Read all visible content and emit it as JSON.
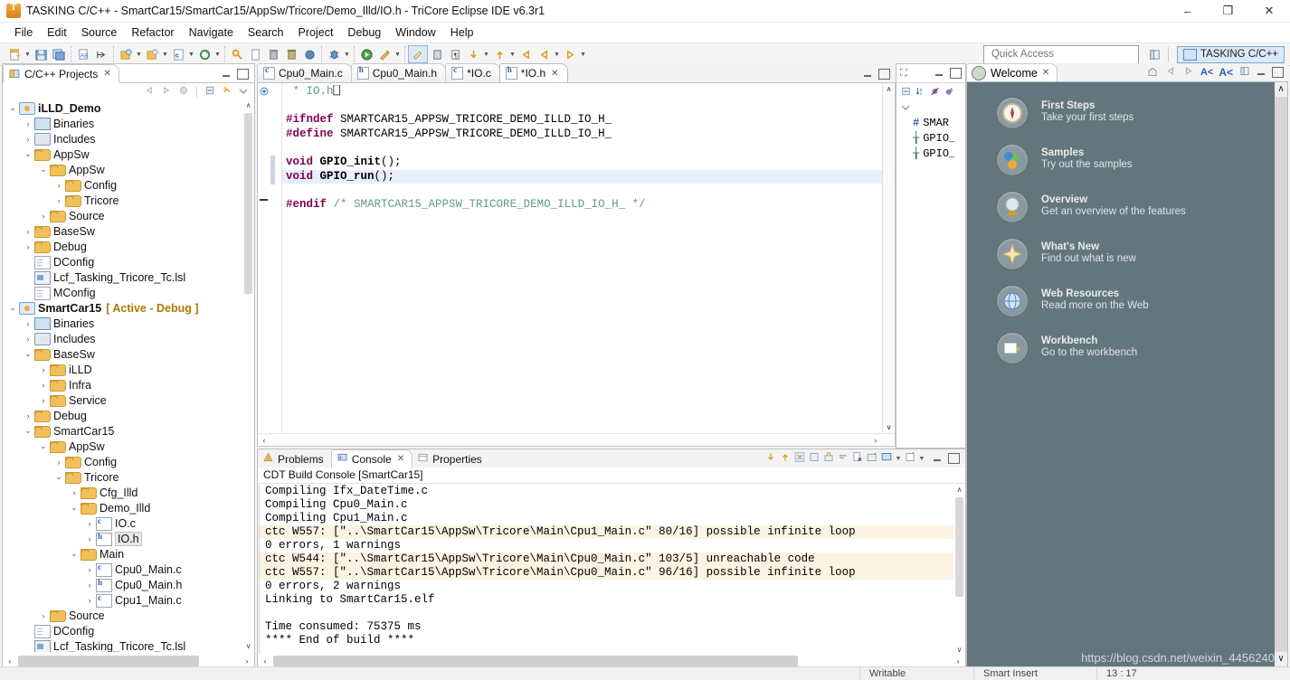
{
  "window": {
    "title": "TASKING C/C++ - SmartCar15/SmartCar15/AppSw/Tricore/Demo_Illd/IO.h - TriCore Eclipse IDE v6.3r1",
    "app_icon": "tasking-icon",
    "minimize": "–",
    "maximize": "❐",
    "close": "✕"
  },
  "menubar": [
    "File",
    "Edit",
    "Source",
    "Refactor",
    "Navigate",
    "Search",
    "Project",
    "Debug",
    "Window",
    "Help"
  ],
  "toolbar": {
    "quick_access_placeholder": "Quick Access",
    "perspective_label": "TASKING C/C++",
    "groups": [
      [
        "new-wizard-icon",
        "▾",
        "save-icon",
        "save-all-icon"
      ],
      [
        "print-icon",
        "next-annotation-icon"
      ],
      [
        "build-icon",
        "▾",
        "clean-icon",
        "▾",
        "build-config-icon",
        "▾",
        "refresh-icon",
        "▾"
      ],
      [
        "search-icon",
        "open-file-icon",
        "delete-icon",
        "trash-icon",
        "scan-icon"
      ],
      [
        "debug-icon",
        "▾"
      ],
      [
        "run-icon",
        "external-tools-icon",
        "▾"
      ],
      [
        "toggle-mark-icon",
        "block-select-icon",
        "show-whitespace-icon",
        "last-edit-icon",
        "▾",
        "next-member-icon",
        "▾",
        "back-icon",
        "forward-icon",
        "▾",
        "forward-nav-icon",
        "▾"
      ]
    ]
  },
  "projects": {
    "tab_label": "C/C++ Projects",
    "toolbar_icons": [
      "back-icon",
      "forward-icon",
      "home-icon",
      "collapse-all-icon",
      "link-editor-icon",
      "view-menu-icon"
    ],
    "tree": [
      {
        "indent": 0,
        "twist": "⌄",
        "icon": "project-icon",
        "label": "iLLD_Demo",
        "bold": true
      },
      {
        "indent": 1,
        "twist": "›",
        "icon": "binaries-icon",
        "label": "Binaries"
      },
      {
        "indent": 1,
        "twist": "›",
        "icon": "includes-icon",
        "label": "Includes"
      },
      {
        "indent": 1,
        "twist": "⌄",
        "icon": "folder-icon",
        "label": "AppSw"
      },
      {
        "indent": 2,
        "twist": "⌄",
        "icon": "folder-icon",
        "label": "AppSw"
      },
      {
        "indent": 3,
        "twist": "›",
        "icon": "folder-icon",
        "label": "Config"
      },
      {
        "indent": 3,
        "twist": "›",
        "icon": "folder-icon",
        "label": "Tricore"
      },
      {
        "indent": 2,
        "twist": "›",
        "icon": "folder-icon",
        "label": "Source"
      },
      {
        "indent": 1,
        "twist": "›",
        "icon": "folder-icon",
        "label": "BaseSw"
      },
      {
        "indent": 1,
        "twist": "›",
        "icon": "folder-icon",
        "label": "Debug"
      },
      {
        "indent": 1,
        "twist": "",
        "icon": "file-icon",
        "label": "DConfig"
      },
      {
        "indent": 1,
        "twist": "",
        "icon": "lsl-icon",
        "label": "Lcf_Tasking_Tricore_Tc.lsl"
      },
      {
        "indent": 1,
        "twist": "",
        "icon": "file-icon",
        "label": "MConfig"
      },
      {
        "indent": 0,
        "twist": "⌄",
        "icon": "project-icon",
        "label": "SmartCar15",
        "bold": true,
        "suffix": "[ Active - Debug ]"
      },
      {
        "indent": 1,
        "twist": "›",
        "icon": "binaries-icon",
        "label": "Binaries"
      },
      {
        "indent": 1,
        "twist": "›",
        "icon": "includes-icon",
        "label": "Includes"
      },
      {
        "indent": 1,
        "twist": "⌄",
        "icon": "folder-icon",
        "label": "BaseSw"
      },
      {
        "indent": 2,
        "twist": "›",
        "icon": "folder-icon",
        "label": "iLLD"
      },
      {
        "indent": 2,
        "twist": "›",
        "icon": "folder-icon",
        "label": "Infra"
      },
      {
        "indent": 2,
        "twist": "›",
        "icon": "folder-icon",
        "label": "Service"
      },
      {
        "indent": 1,
        "twist": "›",
        "icon": "folder-icon",
        "label": "Debug"
      },
      {
        "indent": 1,
        "twist": "⌄",
        "icon": "folder-icon",
        "label": "SmartCar15"
      },
      {
        "indent": 2,
        "twist": "⌄",
        "icon": "folder-icon",
        "label": "AppSw"
      },
      {
        "indent": 3,
        "twist": "›",
        "icon": "folder-icon",
        "label": "Config"
      },
      {
        "indent": 3,
        "twist": "⌄",
        "icon": "folder-icon",
        "label": "Tricore"
      },
      {
        "indent": 4,
        "twist": "›",
        "icon": "folder-icon",
        "label": "Cfg_Illd"
      },
      {
        "indent": 4,
        "twist": "⌄",
        "icon": "folder-icon",
        "label": "Demo_Illd"
      },
      {
        "indent": 5,
        "twist": "›",
        "icon": "c-file-icon",
        "label": "IO.c"
      },
      {
        "indent": 5,
        "twist": "›",
        "icon": "h-file-icon",
        "label": "IO.h",
        "selected": true
      },
      {
        "indent": 4,
        "twist": "⌄",
        "icon": "folder-icon",
        "label": "Main"
      },
      {
        "indent": 5,
        "twist": "›",
        "icon": "c-file-icon",
        "label": "Cpu0_Main.c"
      },
      {
        "indent": 5,
        "twist": "›",
        "icon": "h-file-icon",
        "label": "Cpu0_Main.h"
      },
      {
        "indent": 5,
        "twist": "›",
        "icon": "c-file-icon",
        "label": "Cpu1_Main.c"
      },
      {
        "indent": 2,
        "twist": "›",
        "icon": "folder-icon",
        "label": "Source"
      },
      {
        "indent": 1,
        "twist": "",
        "icon": "file-icon",
        "label": "DConfig"
      },
      {
        "indent": 1,
        "twist": "",
        "icon": "lsl-icon",
        "label": "Lcf_Tasking_Tricore_Tc.lsl"
      },
      {
        "indent": 1,
        "twist": "",
        "icon": "file-icon",
        "label": "MConfig"
      }
    ]
  },
  "editor": {
    "tabs": [
      {
        "label": "Cpu0_Main.c",
        "icon": "c-file-icon",
        "active": false,
        "dirty": false
      },
      {
        "label": "Cpu0_Main.h",
        "icon": "h-file-icon",
        "active": false,
        "dirty": false
      },
      {
        "label": "*IO.c",
        "icon": "c-file-icon",
        "active": false,
        "dirty": true
      },
      {
        "label": "*IO.h",
        "icon": "h-file-icon",
        "active": true,
        "dirty": true
      }
    ],
    "lines": [
      {
        "segments": [
          {
            "t": " * IO.h",
            "c": "cmt"
          },
          {
            "t": "⎕",
            "c": "plain"
          }
        ]
      },
      {
        "segments": []
      },
      {
        "segments": [
          {
            "t": "#ifndef",
            "c": "pp"
          },
          {
            "t": " SMARTCAR15_APPSW_TRICORE_DEMO_ILLD_IO_H_",
            "c": "plain"
          }
        ]
      },
      {
        "segments": [
          {
            "t": "#define",
            "c": "pp"
          },
          {
            "t": " SMARTCAR15_APPSW_TRICORE_DEMO_ILLD_IO_H_",
            "c": "plain"
          }
        ]
      },
      {
        "segments": []
      },
      {
        "segments": [
          {
            "t": "void",
            "c": "kw"
          },
          {
            "t": " ",
            "c": "plain"
          },
          {
            "t": "GPIO_init",
            "c": "fn"
          },
          {
            "t": "();",
            "c": "plain"
          }
        ],
        "changed": true
      },
      {
        "segments": [
          {
            "t": "void",
            "c": "kw"
          },
          {
            "t": " ",
            "c": "plain"
          },
          {
            "t": "GPIO_run",
            "c": "fn"
          },
          {
            "t": "();",
            "c": "plain"
          }
        ],
        "highlight": true,
        "changed": true
      },
      {
        "segments": []
      },
      {
        "segments": [
          {
            "t": "#endif",
            "c": "pp"
          },
          {
            "t": " ",
            "c": "plain"
          },
          {
            "t": "/* SMARTCAR15_APPSW_TRICORE_DEMO_ILLD_IO_H_ */",
            "c": "cmt"
          }
        ]
      }
    ]
  },
  "outline": {
    "tab_icon": "outline-icon",
    "toolbar_icons": [
      "collapse-all-icon",
      "sort-icon",
      "hide-fields-icon",
      "hide-static-icon",
      "view-menu-icon"
    ],
    "items": [
      {
        "icon": "define-icon",
        "glyph": "#",
        "label": "SMAR",
        "kind": "define"
      },
      {
        "icon": "function-icon",
        "glyph": "╁",
        "label": "GPIO_",
        "kind": "function"
      },
      {
        "icon": "function-icon",
        "glyph": "╁",
        "label": "GPIO_",
        "kind": "function"
      }
    ]
  },
  "console": {
    "tabs": [
      {
        "label": "Problems",
        "icon": "problems-icon",
        "active": false
      },
      {
        "label": "Console",
        "icon": "console-icon",
        "active": true
      },
      {
        "label": "Properties",
        "icon": "properties-icon",
        "active": false
      }
    ],
    "toolbar_icons": [
      "scroll-lock-icon",
      "pin-icon",
      "show-console-icon",
      "clear-icon",
      "lock-icon",
      "wrap-icon",
      "remove-icon",
      "new-console-icon",
      "display-console-icon",
      "chevron-down-icon",
      "open-console-icon",
      "chevron-down-icon"
    ],
    "title": "CDT Build Console [SmartCar15]",
    "lines": [
      {
        "text": "Compiling Ifx_DateTime.c",
        "warn": false
      },
      {
        "text": "Compiling Cpu0_Main.c",
        "warn": false
      },
      {
        "text": "Compiling Cpu1_Main.c",
        "warn": false
      },
      {
        "text": "ctc W557: [\"..\\SmartCar15\\AppSw\\Tricore\\Main\\Cpu1_Main.c\" 80/16] possible infinite loop",
        "warn": true
      },
      {
        "text": "0 errors, 1 warnings",
        "warn": false
      },
      {
        "text": "ctc W544: [\"..\\SmartCar15\\AppSw\\Tricore\\Main\\Cpu0_Main.c\" 103/5] unreachable code",
        "warn": true
      },
      {
        "text": "ctc W557: [\"..\\SmartCar15\\AppSw\\Tricore\\Main\\Cpu0_Main.c\" 96/16] possible infinite loop",
        "warn": true
      },
      {
        "text": "0 errors, 2 warnings",
        "warn": false
      },
      {
        "text": "Linking to SmartCar15.elf",
        "warn": false
      },
      {
        "text": "",
        "warn": false
      },
      {
        "text": "Time consumed: 75375 ms",
        "warn": false
      },
      {
        "text": "**** End of build ****",
        "warn": false
      }
    ]
  },
  "welcome": {
    "tab_label": "Welcome",
    "toolbar_icons": [
      "home-icon",
      "back-icon",
      "forward-icon",
      "font-smaller-icon",
      "font-larger-icon",
      "customize-icon"
    ],
    "items": [
      {
        "icon": "compass-icon",
        "title": "First Steps",
        "desc": "Take your first steps"
      },
      {
        "icon": "samples-icon",
        "title": "Samples",
        "desc": "Try out the samples"
      },
      {
        "icon": "globe-icon",
        "title": "Overview",
        "desc": "Get an overview of the features"
      },
      {
        "icon": "star-icon",
        "title": "What's New",
        "desc": "Find out what is new"
      },
      {
        "icon": "web-icon",
        "title": "Web Resources",
        "desc": "Read more on the Web"
      },
      {
        "icon": "workbench-icon",
        "title": "Workbench",
        "desc": "Go to the workbench"
      }
    ],
    "watermark": "https://blog.csdn.net/weixin_4456240"
  },
  "statusbar": {
    "cells": [
      "",
      "Writable",
      "Smart Insert",
      "13 : 17"
    ]
  }
}
